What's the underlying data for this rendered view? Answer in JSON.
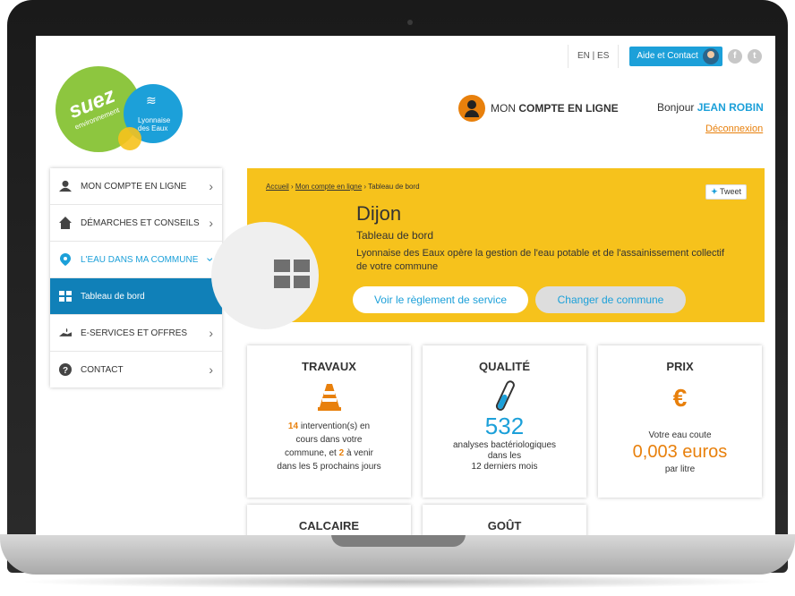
{
  "topbar": {
    "lang": "EN | ES",
    "help": "Aide et Contact",
    "facebook": "f",
    "twitter": "t"
  },
  "logo": {
    "brand": "suez",
    "sub": "environnement",
    "partner_l1": "Lyonnaise",
    "partner_l2": "des Eaux"
  },
  "account": {
    "prefix": "MON",
    "label": "COMPTE EN LIGNE",
    "greeting": "Bonjour",
    "user": "JEAN ROBIN",
    "logout": "Déconnexion"
  },
  "sidebar": {
    "items": [
      {
        "label": "MON COMPTE EN LIGNE",
        "icon": "user-icon"
      },
      {
        "label": "DÉMARCHES ET CONSEILS",
        "icon": "house-icon"
      },
      {
        "label": "L'EAU DANS MA COMMUNE",
        "icon": "location-pin-icon"
      },
      {
        "label": "Tableau de bord",
        "icon": "dashboard-icon"
      },
      {
        "label": "E-SERVICES ET OFFRES",
        "icon": "hand-drop-icon"
      },
      {
        "label": "CONTACT",
        "icon": "question-icon"
      }
    ]
  },
  "banner": {
    "crumbs": [
      "Accueil",
      "Mon compte en ligne",
      "Tableau de bord"
    ],
    "tweet": "Tweet",
    "city": "Dijon",
    "subtitle": "Tableau de bord",
    "description": "Lyonnaise des Eaux opère la gestion de l'eau potable et de l'assainissement collectif de votre commune",
    "btn_rules": "Voir le règlement de service",
    "btn_change": "Changer de commune"
  },
  "cards": {
    "travaux": {
      "title": "TRAVAUX",
      "count": "14",
      "t1": "intervention(s) en",
      "t2": "cours dans votre",
      "t3": "commune, et",
      "upcoming": "2",
      "t4": "à venir",
      "t5": "dans les 5 prochains jours"
    },
    "qualite": {
      "title": "QUALITÉ",
      "number": "532",
      "t1": "analyses bactériologiques",
      "t2": "dans les",
      "t3": "12 derniers mois"
    },
    "prix": {
      "title": "PRIX",
      "symbol": "€",
      "t1": "Votre eau coute",
      "price": "0,003 euros",
      "t2": "par litre"
    },
    "calcaire": {
      "title": "CALCAIRE"
    },
    "gout": {
      "title": "GOÛT"
    }
  },
  "colors": {
    "accent": "#1ca0d9",
    "banner": "#f6c21c",
    "orange": "#e8800c",
    "green": "#8dc63f"
  }
}
